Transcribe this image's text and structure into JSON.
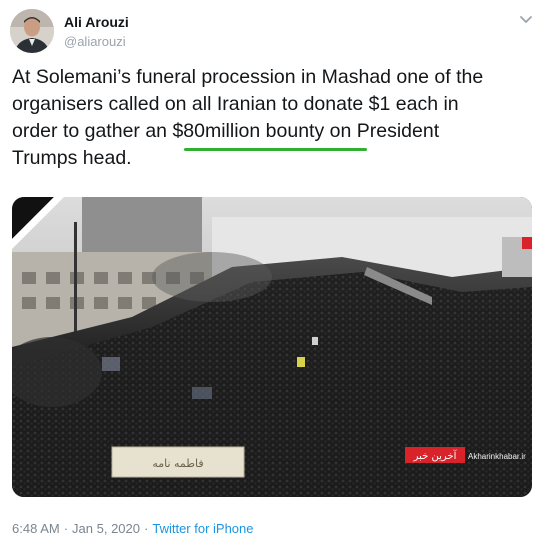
{
  "author": {
    "name": "Ali Arouzi",
    "handle": "@aliarouzi"
  },
  "tweet": {
    "line1": "At Solemani’s funeral procession in Mashad one of the",
    "line2": "organisers called on all Iranian to donate $1 each in",
    "line3_pre": "order to gather an ",
    "line3_highlight": "$80million bounty",
    "line3_post": " on President",
    "line4": "Trumps head."
  },
  "media": {
    "banner_text": "فاطمه نامه",
    "watermark_logo": "آخرین خبر",
    "watermark_site": "Akharinkhabar.ir"
  },
  "meta": {
    "time": "6:48 AM",
    "date": "Jan 5, 2020",
    "source": "Twitter for iPhone"
  },
  "colors": {
    "underline": "#2fb030",
    "link": "#1b95e0",
    "watermark_red": "#d8232a"
  },
  "icons": [
    "avatar",
    "chevron-down-icon",
    "mourning-ribbon-icon"
  ]
}
